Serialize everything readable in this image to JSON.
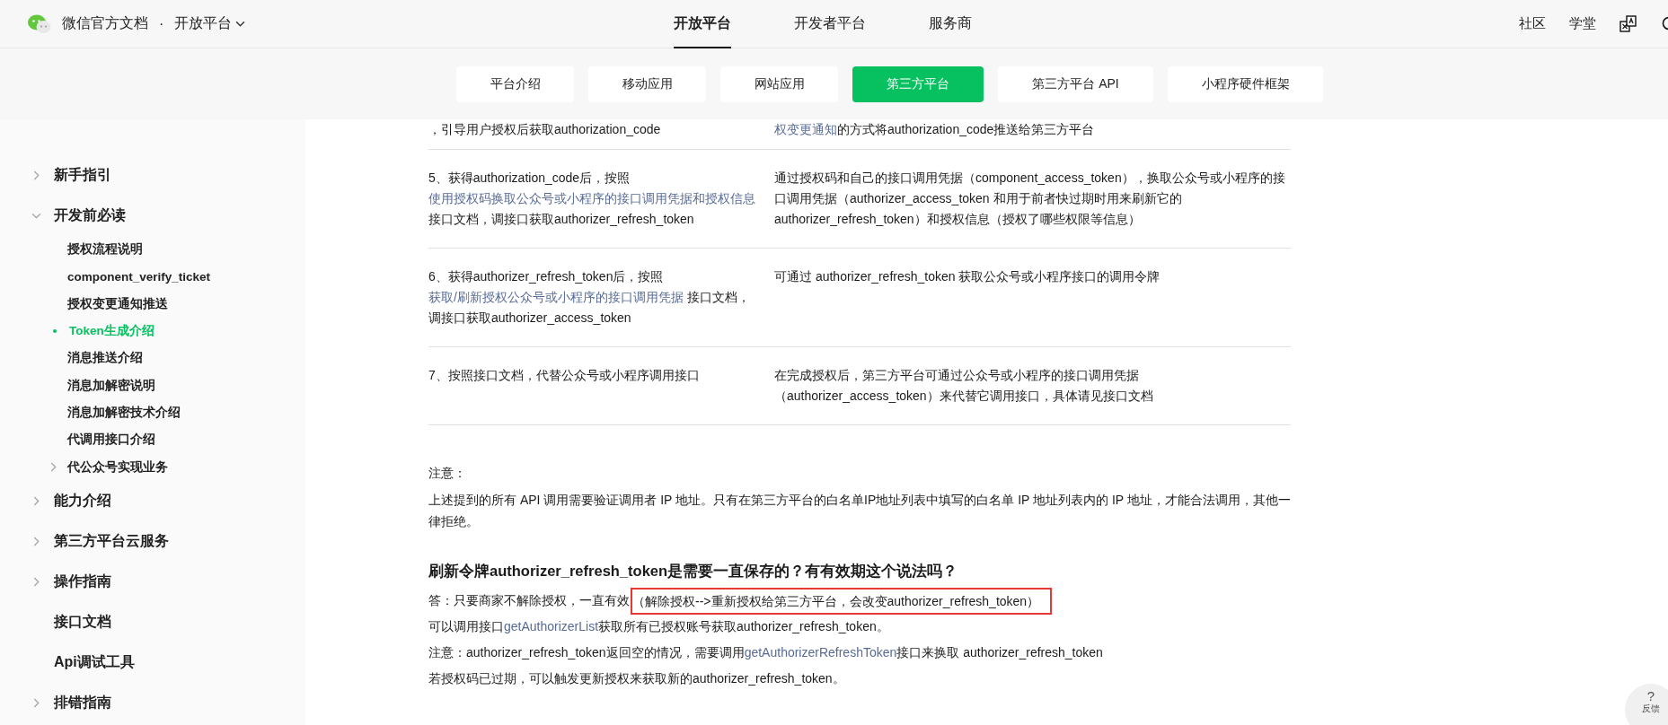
{
  "header": {
    "site_title": "微信官方文档",
    "separator": "·",
    "product": "开放平台",
    "top_nav": [
      {
        "label": "开放平台",
        "selected": true
      },
      {
        "label": "开发者平台",
        "selected": false
      },
      {
        "label": "服务商",
        "selected": false
      }
    ],
    "right_links": [
      "社区",
      "学堂"
    ]
  },
  "sub_nav": [
    {
      "label": "平台介绍",
      "selected": false
    },
    {
      "label": "移动应用",
      "selected": false
    },
    {
      "label": "网站应用",
      "selected": false
    },
    {
      "label": "第三方平台",
      "selected": true
    },
    {
      "label": "第三方平台 API",
      "selected": false
    },
    {
      "label": "小程序硬件框架",
      "selected": false
    }
  ],
  "sidebar": {
    "items": [
      {
        "label": "新手指引",
        "expanded": false,
        "selected": false
      },
      {
        "label": "开发前必读",
        "expanded": true,
        "selected": false,
        "children": [
          {
            "label": "授权流程说明",
            "selected": false
          },
          {
            "label": "component_verify_ticket",
            "selected": false
          },
          {
            "label": "授权变更通知推送",
            "selected": false
          },
          {
            "label": "Token生成介绍",
            "selected": true
          },
          {
            "label": "消息推送介绍",
            "selected": false
          },
          {
            "label": "消息加解密说明",
            "selected": false
          },
          {
            "label": "消息加解密技术介绍",
            "selected": false
          },
          {
            "label": "代调用接口介绍",
            "selected": false
          },
          {
            "label": "代公众号实现业务",
            "selected": false,
            "expanded": false
          }
        ]
      },
      {
        "label": "能力介绍",
        "expanded": false,
        "selected": false
      },
      {
        "label": "第三方平台云服务",
        "expanded": false,
        "selected": false
      },
      {
        "label": "操作指南",
        "expanded": false,
        "selected": false
      },
      {
        "label": "接口文档",
        "selected": false
      },
      {
        "label": "Api调试工具",
        "selected": false
      },
      {
        "label": "排错指南",
        "expanded": false,
        "selected": false
      }
    ]
  },
  "table": {
    "rows": [
      {
        "step": [
          {
            "text": "，引导用户授权后获取authorization_code"
          }
        ],
        "description": [
          {
            "text": "权变更通知",
            "link": true
          },
          {
            "text": "的方式将authorization_code推送给第三方平台"
          }
        ]
      },
      {
        "step": [
          {
            "text": "5、获得authorization_code后，按照"
          },
          {
            "text": "使用授权码换取公众号或小程序的接口调用凭据和授权信息",
            "link": true
          },
          {
            "text": " 接口文档，调接口获取authorizer_refresh_token"
          }
        ],
        "description": [
          {
            "text": "通过授权码和自己的接口调用凭据（component_access_token），换取公众号或小程序的接口调用凭据（authorizer_access_token 和用于前者快过期时用来刷新它的 authorizer_refresh_token）和授权信息（授权了哪些权限等信息）"
          }
        ]
      },
      {
        "step": [
          {
            "text": "6、获得authorizer_refresh_token后，按照"
          },
          {
            "text": "获取/刷新授权公众号或小程序的接口调用凭据",
            "link": true
          },
          {
            "text": " 接口文档，调接口获取authorizer_access_token"
          }
        ],
        "description": [
          {
            "text": "可通过 authorizer_refresh_token 获取公众号或小程序接口的调用令牌"
          }
        ]
      },
      {
        "step": [
          {
            "text": "7、按照接口文档，代替公众号或小程序调用接口"
          }
        ],
        "description": [
          {
            "text": "在完成授权后，第三方平台可通过公众号或小程序的接口调用凭据（authorizer_access_token）来代替它调用接口，具体请见接口文档"
          }
        ]
      }
    ]
  },
  "note": {
    "title": "注意：",
    "text": "上述提到的所有 API 调用需要验证调用者 IP 地址。只有在第三方平台的白名单IP地址列表中填写的白名单 IP 地址列表内的 IP 地址，才能合法调用，其他一律拒绝。"
  },
  "faq": {
    "question": "刷新令牌authorizer_refresh_token是需要一直保存的？有有效期这个说法吗？",
    "answer_lead": "答：只要商家不解除授权，一直有效",
    "answer_highlight": "（解除授权-->重新授权给第三方平台，会改变authorizer_refresh_token）",
    "lines": [
      [
        {
          "text": "可以调用接口"
        },
        {
          "text": "getAuthorizerList",
          "link": true
        },
        {
          "text": "获取所有已授权账号获取authorizer_refresh_token。"
        }
      ],
      [
        {
          "text": "注意：authorizer_refresh_token返回空的情况，需要调用"
        },
        {
          "text": "getAuthorizerRefreshToken",
          "link": true
        },
        {
          "text": "接口来换取 authorizer_refresh_token"
        }
      ],
      [
        {
          "text": "若授权码已过期，可以触发更新授权来获取新的authorizer_refresh_token。"
        }
      ]
    ]
  },
  "feedback": {
    "icon_text": "?",
    "label": "反馈"
  }
}
